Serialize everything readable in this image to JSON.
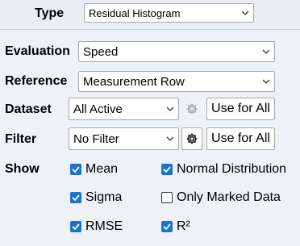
{
  "type_row": {
    "label": "Type",
    "value": "Residual Histogram"
  },
  "evaluation": {
    "label": "Evaluation",
    "value": "Speed"
  },
  "reference": {
    "label": "Reference",
    "value": "Measurement Row"
  },
  "dataset": {
    "label": "Dataset",
    "value": "All Active",
    "button": "Use for All"
  },
  "filter": {
    "label": "Filter",
    "value": "No Filter",
    "button": "Use for All"
  },
  "show": {
    "label": "Show",
    "options": [
      {
        "label": "Mean",
        "checked": true
      },
      {
        "label": "Normal Distribution",
        "checked": true
      },
      {
        "label": "Sigma",
        "checked": true
      },
      {
        "label": "Only Marked Data",
        "checked": false
      },
      {
        "label": "RMSE",
        "checked": true
      },
      {
        "label": "R²",
        "checked": true
      }
    ]
  },
  "colors": {
    "accent": "#1a73d1",
    "panel": "#eef1f6",
    "header": "#eaeef4"
  }
}
